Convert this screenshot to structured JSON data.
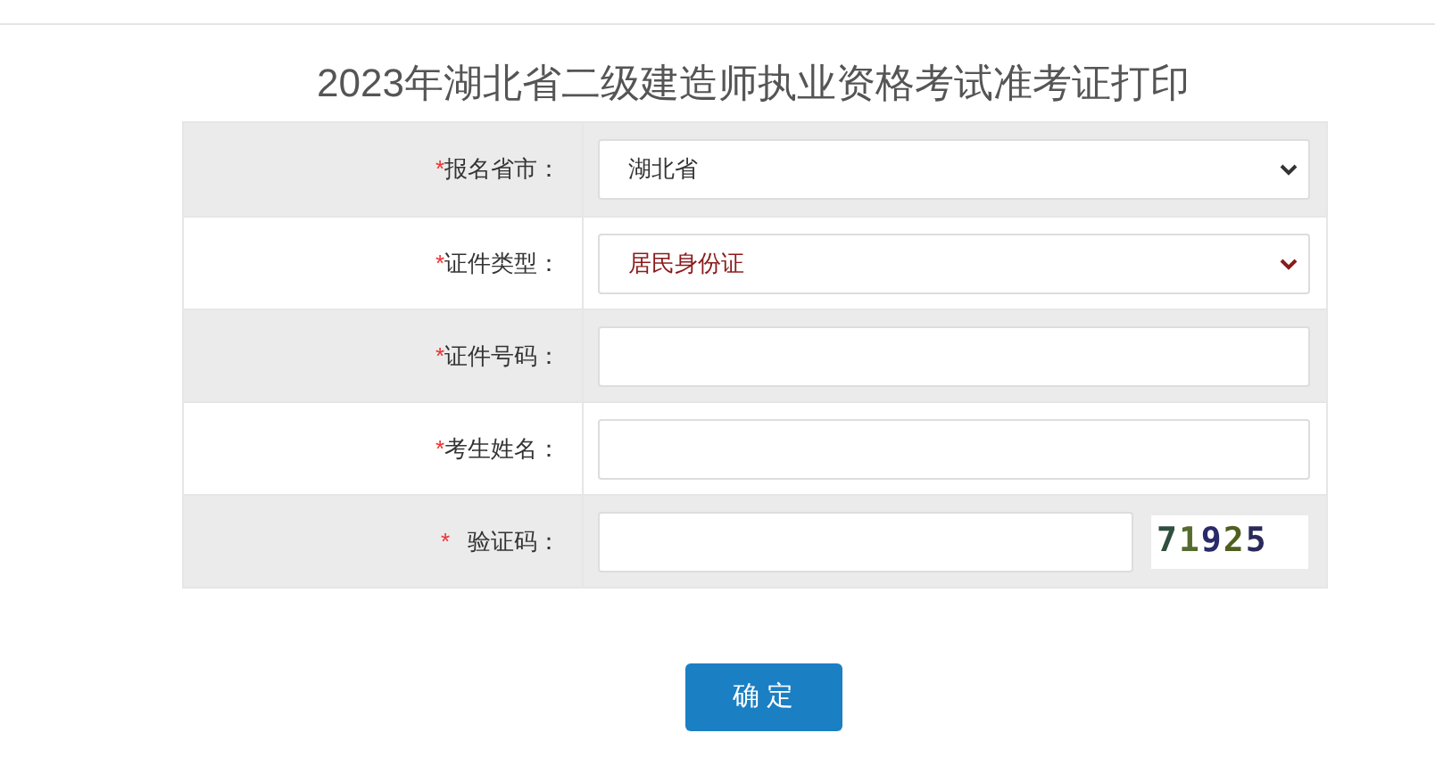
{
  "title": "2023年湖北省二级建造师执业资格考试准考证打印",
  "rows": [
    {
      "kind": "select",
      "mark": "*",
      "label": "报名省市：",
      "value": "湖北省",
      "color": "#333333"
    },
    {
      "kind": "select",
      "mark": "*",
      "label": "证件类型：",
      "value": "居民身份证",
      "color": "#8b1a1a"
    },
    {
      "kind": "input",
      "mark": "*",
      "label": "证件号码："
    },
    {
      "kind": "input",
      "mark": "*",
      "label": "考生姓名："
    },
    {
      "kind": "captcha",
      "mark": "*",
      "label": "验证码：",
      "captcha": "71925"
    }
  ],
  "submit": "确 定"
}
